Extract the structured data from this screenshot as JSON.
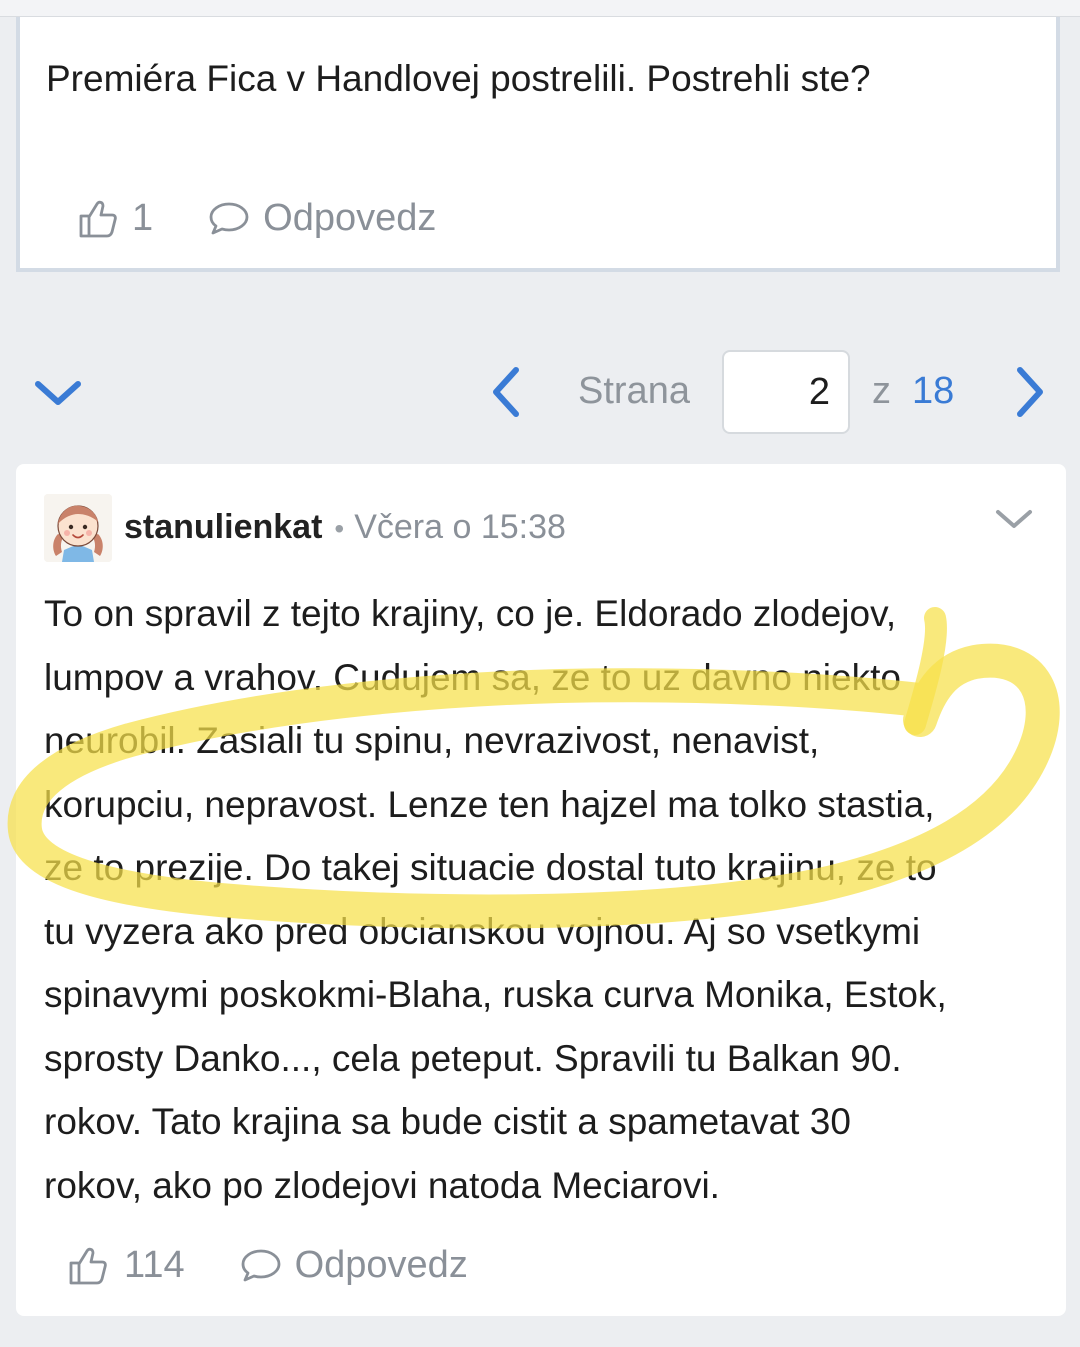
{
  "previous_comment": {
    "text": "Premiéra Fica v Handlovej postrelili. Postrehli ste?",
    "likes": "1",
    "reply_label": "Odpovedz"
  },
  "pagination": {
    "page_label": "Strana",
    "current_page": "2",
    "of_label": "z",
    "total_pages": "18"
  },
  "comment": {
    "username": "stanulienkat",
    "separator": "•",
    "timestamp": "Včera o 15:38",
    "lines": [
      "To on spravil z tejto krajiny, co je. Eldorado zlodejov,",
      "lumpov a vrahov. Cudujem sa, ze to uz davno niekto",
      "neurobil. Zasiali tu spinu, nevrazivost, nenavist,",
      "korupciu, nepravost. Lenze ten hajzel ma tolko stastia,",
      "ze to prezije. Do takej situacie dostal tuto krajinu, ze to",
      "tu vyzera ako pred obcianskou vojnou. Aj so vsetkymi",
      "spinavymi poskokmi-Blaha, ruska curva Monika, Estok,",
      "sprosty Danko..., cela peteput. Spravili tu Balkan 90.",
      "rokov. Tato krajina sa bude cistit a spametavat 30",
      "rokov, ako po zlodejovi natoda Meciarovi."
    ],
    "likes": "114",
    "reply_label": "Odpovedz"
  },
  "icons": {
    "like": "thumbs-up-icon",
    "reply": "speech-bubble-icon",
    "collapse": "chevron-down-icon",
    "prev": "chevron-left-icon",
    "next": "chevron-right-icon",
    "menu": "chevron-down-icon"
  },
  "colors": {
    "accent": "#3a7bd5",
    "muted": "#8a9098",
    "highlight_marker": "#f6e04a",
    "card_border": "#d3dbe5",
    "background": "#eceef1"
  }
}
